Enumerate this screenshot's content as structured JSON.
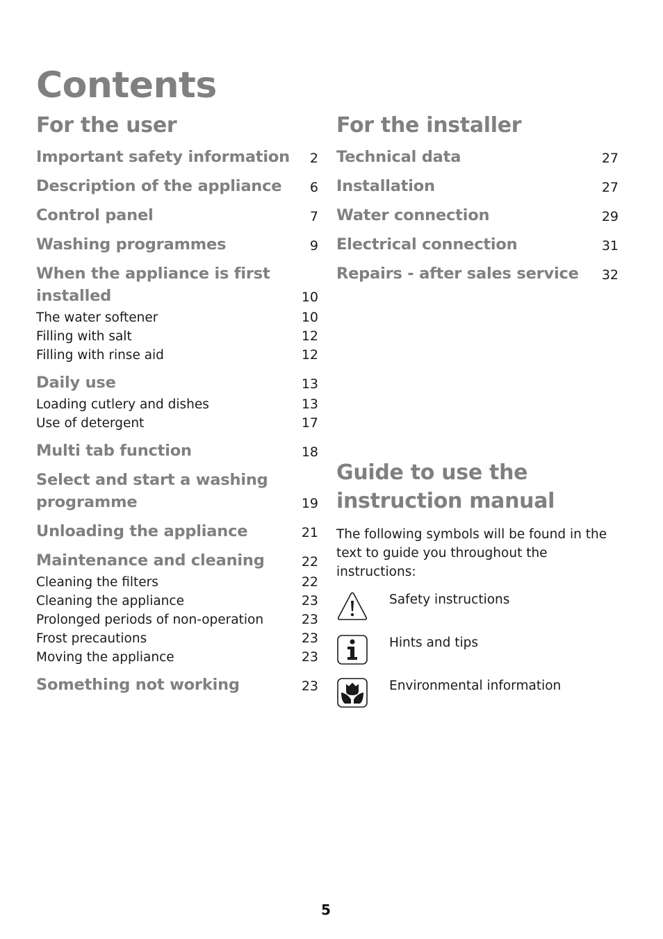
{
  "page": {
    "title": "Contents",
    "page_number": "5"
  },
  "user_section": {
    "heading": "For the user",
    "entries": [
      {
        "title": "Important safety information",
        "page": "2"
      },
      {
        "title": "Description of the appliance",
        "page": "6"
      },
      {
        "title": "Control panel",
        "page": "7"
      },
      {
        "title": "Washing programmes",
        "page": "9"
      },
      {
        "title_line1": "When the appliance is first",
        "title_line2": "installed",
        "page": "10",
        "subs": [
          {
            "title": "The water softener",
            "page": "10"
          },
          {
            "title": "Filling with salt",
            "page": "12"
          },
          {
            "title": "Filling with rinse aid",
            "page": "12"
          }
        ]
      },
      {
        "title": "Daily use",
        "page": "13",
        "subs": [
          {
            "title": "Loading cutlery and dishes",
            "page": "13"
          },
          {
            "title": "Use of detergent",
            "page": "17"
          }
        ]
      },
      {
        "title": "Multi tab function",
        "page": "18"
      },
      {
        "title_line1": "Select and start a washing",
        "title_line2": "programme",
        "page": "19"
      },
      {
        "title": "Unloading the appliance",
        "page": "21"
      },
      {
        "title": "Maintenance and cleaning",
        "page": "22",
        "subs": [
          {
            "title": "Cleaning the filters",
            "page": "22"
          },
          {
            "title": "Cleaning the appliance",
            "page": "23"
          },
          {
            "title": "Prolonged periods of non-operation",
            "page": "23"
          },
          {
            "title": "Frost precautions",
            "page": "23"
          },
          {
            "title": "Moving the appliance",
            "page": "23"
          }
        ]
      },
      {
        "title": "Something not working",
        "page": "23"
      }
    ]
  },
  "installer_section": {
    "heading": "For the installer",
    "entries": [
      {
        "title": "Technical data",
        "page": "27"
      },
      {
        "title": "Installation",
        "page": "27"
      },
      {
        "title": "Water connection",
        "page": "29"
      },
      {
        "title": "Electrical connection",
        "page": "31"
      },
      {
        "title": "Repairs - after sales service",
        "page": "32"
      }
    ]
  },
  "guide": {
    "heading_line1": "Guide to use the",
    "heading_line2": "instruction manual",
    "intro": "The following symbols will be found in the text to guide you throughout the instructions:",
    "symbols": [
      {
        "icon": "warning-triangle-icon",
        "label": "Safety instructions"
      },
      {
        "icon": "info-icon",
        "label": "Hints and tips"
      },
      {
        "icon": "flower-environment-icon",
        "label": "Environmental information"
      }
    ]
  },
  "colors": {
    "heading_gray": "#808080",
    "body_text": "#1a1a1a"
  }
}
